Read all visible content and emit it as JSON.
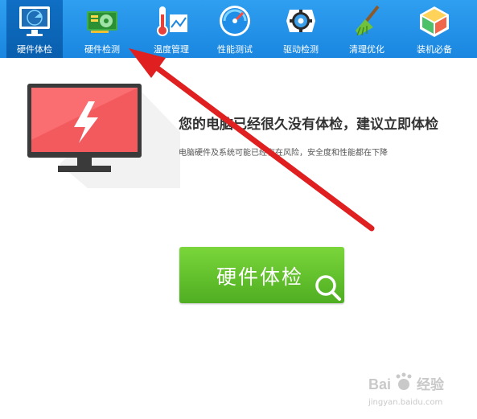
{
  "toolbar": {
    "items": [
      {
        "label": "硬件体检",
        "icon": "radar-monitor-icon",
        "active": true
      },
      {
        "label": "硬件检测",
        "icon": "graphics-card-icon",
        "active": false
      },
      {
        "label": "温度管理",
        "icon": "thermometer-icon",
        "active": false
      },
      {
        "label": "性能测试",
        "icon": "speedometer-icon",
        "active": false
      },
      {
        "label": "驱动检测",
        "icon": "gear-driver-icon",
        "active": false
      },
      {
        "label": "清理优化",
        "icon": "broom-icon",
        "active": false
      },
      {
        "label": "装机必备",
        "icon": "cube-box-icon",
        "active": false
      }
    ]
  },
  "main": {
    "illustration": "monitor-lightning-icon",
    "headline": "您的电脑已经很久没有体检，建议立即体检",
    "subtext": "电脑硬件及系统可能已经存在风险，安全度和性能都在下降",
    "button_label": "硬件体检"
  },
  "annotation": {
    "type": "red-arrow",
    "color": "#e02020"
  },
  "watermark": {
    "brand": "经验",
    "url": "jingyan.baidu.com"
  },
  "colors": {
    "toolbar": "#1a86e0",
    "active_tab": "#0a5fae",
    "button": "#5cbf2a",
    "screen": "#f25a5e"
  }
}
